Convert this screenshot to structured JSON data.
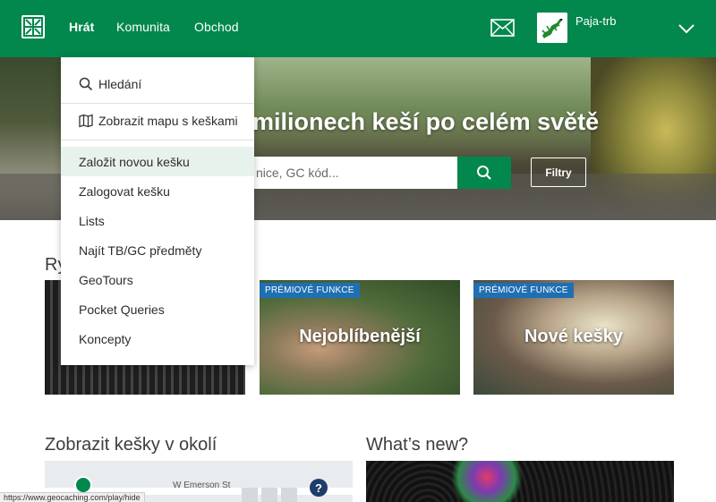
{
  "header": {
    "nav": [
      "Hrát",
      "Komunita",
      "Obchod"
    ],
    "username": "Paja-trb",
    "colors": {
      "brand": "#02874d"
    },
    "icons": [
      "geocaching-logo",
      "mail-icon",
      "chevron-down-icon"
    ]
  },
  "hero": {
    "title": "milionech keší po celém světě",
    "search_placeholder": "nice, GC kód...",
    "filters_label": "Filtry"
  },
  "menu": {
    "search_label": "Hledání",
    "map_label": "Zobrazit mapu s keškami",
    "items": [
      "Založit novou kešku",
      "Zalogovat kešku",
      "Lists",
      "Najít TB/GC předměty",
      "GeoTours",
      "Pocket Queries",
      "Koncepty"
    ]
  },
  "sections": {
    "featured_title_partial": "Ry",
    "nearby_title": "Zobrazit kešky v okolí",
    "news_title": "What’s new?"
  },
  "cards": [
    {
      "badge": "PRÉMIOVÉ FUNKCE",
      "title": "Nejoblíbenější"
    },
    {
      "badge": "PRÉMIOVÉ FUNKCE",
      "title": "Nové kešky"
    }
  ],
  "map": {
    "road_label": "W Emerson St"
  },
  "status_bar": {
    "url": "https://www.geocaching.com/play/hide"
  }
}
